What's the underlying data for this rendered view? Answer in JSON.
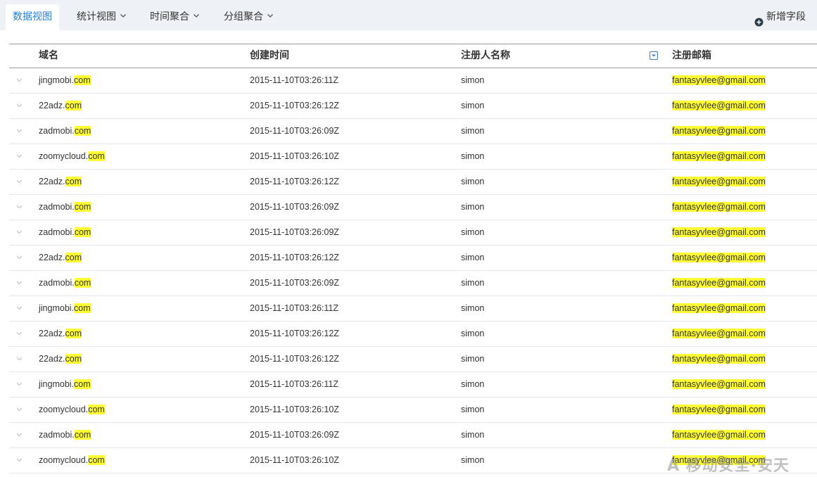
{
  "tabs": [
    {
      "label": "数据视图",
      "active": true
    },
    {
      "label": "统计视图",
      "dropdown": true
    },
    {
      "label": "时间聚合",
      "dropdown": true
    },
    {
      "label": "分组聚合",
      "dropdown": true
    }
  ],
  "add_field_label": "新增字段",
  "columns": [
    "域名",
    "创建时间",
    "注册人名称",
    "注册邮箱"
  ],
  "highlight_term": "com",
  "rows": [
    {
      "domain_name": "jingmobi.",
      "created": "2015-11-10T03:26:11Z",
      "registrant": "simon",
      "email_user": "fantasyvlee@gmail."
    },
    {
      "domain_name": "22adz.",
      "created": "2015-11-10T03:26:12Z",
      "registrant": "simon",
      "email_user": "fantasyvlee@gmail."
    },
    {
      "domain_name": "zadmobi.",
      "created": "2015-11-10T03:26:09Z",
      "registrant": "simon",
      "email_user": "fantasyvlee@gmail."
    },
    {
      "domain_name": "zoomycloud.",
      "created": "2015-11-10T03:26:10Z",
      "registrant": "simon",
      "email_user": "fantasyvlee@gmail."
    },
    {
      "domain_name": "22adz.",
      "created": "2015-11-10T03:26:12Z",
      "registrant": "simon",
      "email_user": "fantasyvlee@gmail."
    },
    {
      "domain_name": "zadmobi.",
      "created": "2015-11-10T03:26:09Z",
      "registrant": "simon",
      "email_user": "fantasyvlee@gmail."
    },
    {
      "domain_name": "zadmobi.",
      "created": "2015-11-10T03:26:09Z",
      "registrant": "simon",
      "email_user": "fantasyvlee@gmail."
    },
    {
      "domain_name": "22adz.",
      "created": "2015-11-10T03:26:12Z",
      "registrant": "simon",
      "email_user": "fantasyvlee@gmail."
    },
    {
      "domain_name": "zadmobi.",
      "created": "2015-11-10T03:26:09Z",
      "registrant": "simon",
      "email_user": "fantasyvlee@gmail."
    },
    {
      "domain_name": "jingmobi.",
      "created": "2015-11-10T03:26:11Z",
      "registrant": "simon",
      "email_user": "fantasyvlee@gmail."
    },
    {
      "domain_name": "22adz.",
      "created": "2015-11-10T03:26:12Z",
      "registrant": "simon",
      "email_user": "fantasyvlee@gmail."
    },
    {
      "domain_name": "22adz.",
      "created": "2015-11-10T03:26:12Z",
      "registrant": "simon",
      "email_user": "fantasyvlee@gmail."
    },
    {
      "domain_name": "jingmobi.",
      "created": "2015-11-10T03:26:11Z",
      "registrant": "simon",
      "email_user": "fantasyvlee@gmail."
    },
    {
      "domain_name": "zoomycloud.",
      "created": "2015-11-10T03:26:10Z",
      "registrant": "simon",
      "email_user": "fantasyvlee@gmail."
    },
    {
      "domain_name": "zadmobi.",
      "created": "2015-11-10T03:26:09Z",
      "registrant": "simon",
      "email_user": "fantasyvlee@gmail."
    },
    {
      "domain_name": "zoomycloud.",
      "created": "2015-11-10T03:26:10Z",
      "registrant": "simon",
      "email_user": "fantasyvlee@gmail."
    }
  ],
  "watermark": "A 移动安全·安天",
  "colors": {
    "accent": "#1f80d5",
    "highlight": "#ffff33",
    "tabbar_bg": "#eef1f5"
  },
  "icons": {
    "tab_dropdown": "chevron-down-icon",
    "add_field": "plus-circle-icon",
    "column_filter": "filter-dropdown-icon",
    "row_expand": "chevron-down-icon"
  }
}
